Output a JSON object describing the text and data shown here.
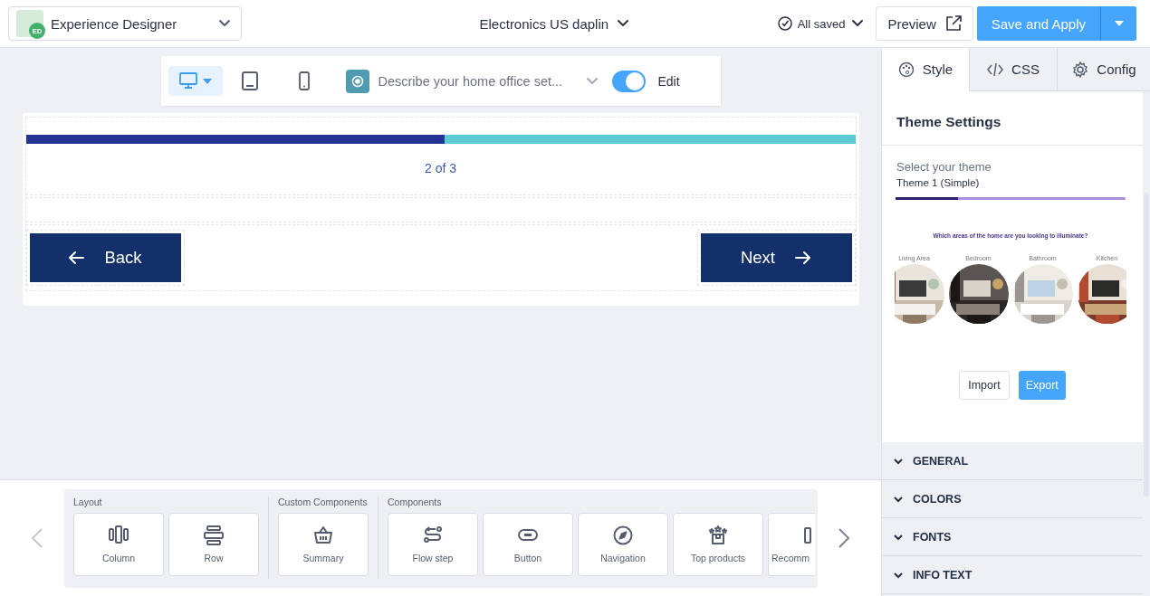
{
  "header": {
    "app_badge": "ED",
    "app_name": "Experience Designer",
    "project": "Electronics US daplin",
    "save_status": "All saved",
    "preview_button": "Preview",
    "save_button": "Save and Apply"
  },
  "canvas_toolbar": {
    "devices": [
      {
        "kind": "desktop",
        "selected": true
      },
      {
        "kind": "tablet",
        "selected": false
      },
      {
        "kind": "mobile",
        "selected": false
      }
    ],
    "question": "Describe your home office set...",
    "edit_toggle": {
      "label": "Edit",
      "on": true
    }
  },
  "flow_preview": {
    "progress": {
      "level": 0.505
    },
    "step_label": "2 of 3",
    "back_button": "Back",
    "next_button": "Next"
  },
  "side_panel": {
    "tabs": [
      {
        "label": "Style",
        "kind": "style",
        "selected": true
      },
      {
        "label": "CSS",
        "kind": "css",
        "selected": false
      },
      {
        "label": "Config",
        "kind": "config",
        "selected": false
      }
    ],
    "heading": "Theme Settings",
    "theme_label": "Select your theme",
    "theme_value": "Theme 1 (Simple)",
    "theme_preview": {
      "progress": {
        "level": 0.27
      },
      "question": "Which areas of the home are you looking to illuminate?",
      "options": [
        {
          "label": "Living Area",
          "kind": "picture"
        },
        {
          "label": "Bedroom",
          "kind": "picture"
        },
        {
          "label": "Bathroom",
          "kind": "picture"
        },
        {
          "label": "Kitchen",
          "kind": "picture"
        }
      ]
    },
    "import_button": "Import",
    "export_button": "Export",
    "sections": [
      {
        "label": "GENERAL",
        "expanded": false
      },
      {
        "label": "COLORS",
        "expanded": false
      },
      {
        "label": "FONTS",
        "expanded": false
      },
      {
        "label": "INFO TEXT",
        "expanded": false
      }
    ]
  },
  "component_palette": {
    "groups": [
      {
        "title": "Layout",
        "items": [
          {
            "label": "Column",
            "kind": "column"
          },
          {
            "label": "Row",
            "kind": "row"
          }
        ]
      },
      {
        "title": "Custom Components",
        "items": [
          {
            "label": "Summary",
            "kind": "basket"
          }
        ]
      },
      {
        "title": "Components",
        "items": [
          {
            "label": "Flow step",
            "kind": "flow"
          },
          {
            "label": "Button",
            "kind": "button"
          },
          {
            "label": "Navigation",
            "kind": "compass"
          },
          {
            "label": "Top products",
            "kind": "stars"
          },
          {
            "label": "Recomm",
            "kind": "partial"
          }
        ]
      }
    ]
  }
}
